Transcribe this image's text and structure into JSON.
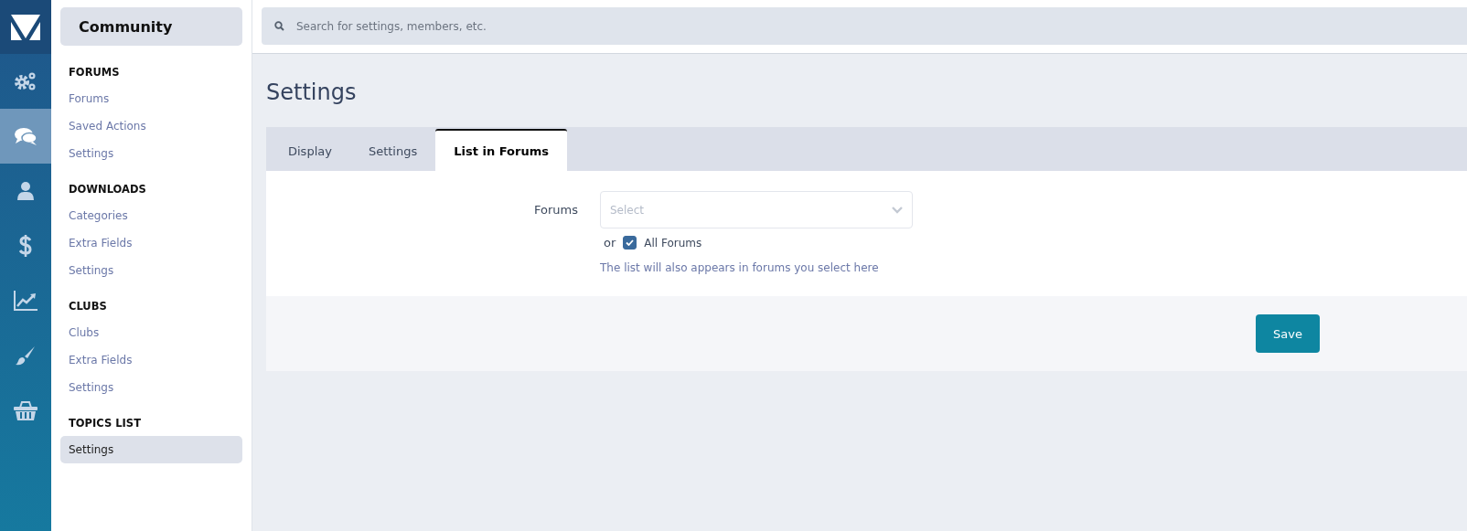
{
  "rail": [
    {
      "kind": "gears",
      "selected": false
    },
    {
      "kind": "chat",
      "selected": true
    },
    {
      "kind": "user",
      "selected": false
    },
    {
      "kind": "dollar",
      "selected": false
    },
    {
      "kind": "chart",
      "selected": false
    },
    {
      "kind": "brush",
      "selected": false
    },
    {
      "kind": "basket",
      "selected": false
    }
  ],
  "sidebar": {
    "title": "Community",
    "sections": [
      {
        "heading": "FORUMS",
        "items": [
          {
            "label": "Forums",
            "selected": false
          },
          {
            "label": "Saved Actions",
            "selected": false
          },
          {
            "label": "Settings",
            "selected": false
          }
        ]
      },
      {
        "heading": "DOWNLOADS",
        "items": [
          {
            "label": "Categories",
            "selected": false
          },
          {
            "label": "Extra Fields",
            "selected": false
          },
          {
            "label": "Settings",
            "selected": false
          }
        ]
      },
      {
        "heading": "CLUBS",
        "items": [
          {
            "label": "Clubs",
            "selected": false
          },
          {
            "label": "Extra Fields",
            "selected": false
          },
          {
            "label": "Settings",
            "selected": false
          }
        ]
      },
      {
        "heading": "TOPICS LIST",
        "items": [
          {
            "label": "Settings",
            "selected": true
          }
        ]
      }
    ]
  },
  "search": {
    "placeholder": "Search for settings, members, etc."
  },
  "page_title": "Settings",
  "tabs": [
    {
      "label": "Display",
      "selected": false
    },
    {
      "label": "Settings",
      "selected": false
    },
    {
      "label": "List in Forums",
      "selected": true
    }
  ],
  "form": {
    "label": "Forums",
    "select_placeholder": "Select",
    "or_text": "or",
    "all_checkbox": {
      "label": "All Forums",
      "checked": true
    },
    "hint": "The list will also appears in forums you select here"
  },
  "save_button": "Save"
}
